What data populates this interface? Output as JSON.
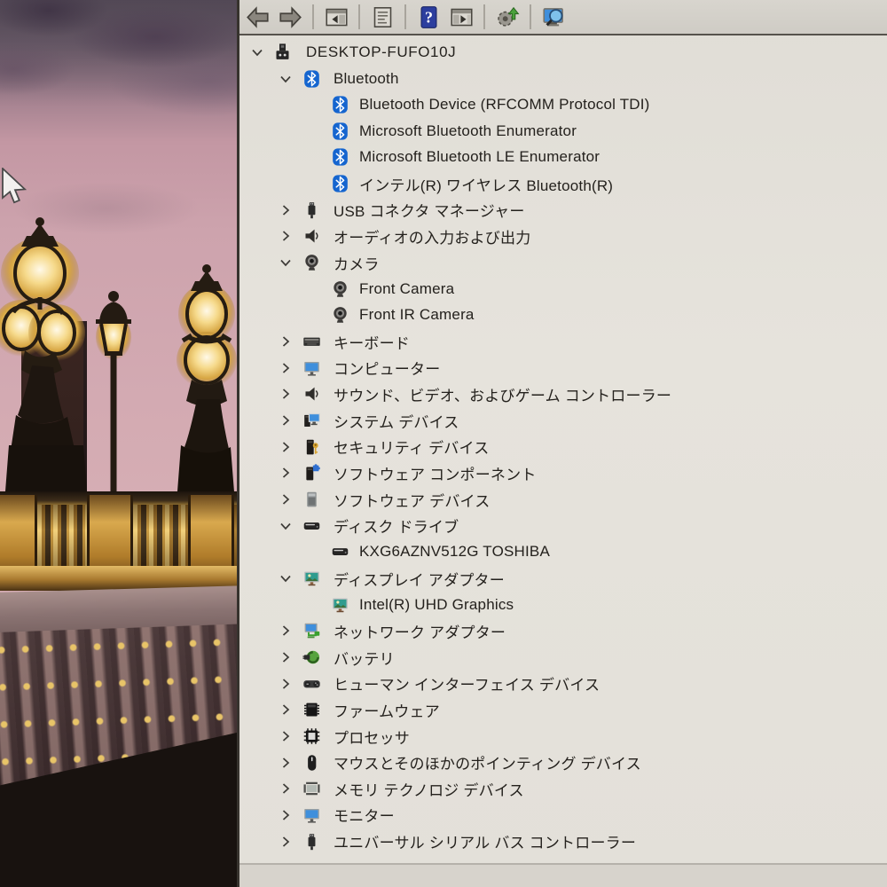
{
  "app": "device-manager",
  "colors": {
    "bluetooth_blue": "#1565cf",
    "help_blue": "#2c3e9e",
    "screen_blue": "#3f8fdc",
    "update_green": "#4aa23c",
    "gold": "#d9a94e",
    "sky_pink": "#d0a6af",
    "toolbar_bg": "#d3d0c9",
    "pane_bg": "#e2dfd8",
    "text": "#26231f"
  },
  "toolbar": {
    "items": [
      {
        "name": "back-button",
        "icon": "tb-back"
      },
      {
        "name": "forward-button",
        "icon": "tb-forward"
      },
      {
        "separator": true
      },
      {
        "name": "show-console-tree-button",
        "icon": "tb-console"
      },
      {
        "separator": true
      },
      {
        "name": "properties-button",
        "icon": "tb-props"
      },
      {
        "separator": true
      },
      {
        "name": "help-button",
        "icon": "tb-help"
      },
      {
        "name": "show-action-pane-button",
        "icon": "tb-action"
      },
      {
        "separator": true
      },
      {
        "name": "update-driver-button",
        "icon": "tb-update"
      },
      {
        "separator": true
      },
      {
        "name": "scan-hardware-changes-button",
        "icon": "tb-scan"
      }
    ]
  },
  "tree": {
    "rows": [
      {
        "id": "desktop-fufo10j",
        "label": "DESKTOP-FUFO10J",
        "icon": "computer",
        "level": 0,
        "chevron": "expanded"
      },
      {
        "id": "bluetooth",
        "label": "Bluetooth",
        "icon": "bluetooth",
        "level": 1,
        "chevron": "expanded"
      },
      {
        "id": "bluetooth-device-rfcomm-protocol-tdi",
        "label": "Bluetooth Device (RFCOMM Protocol TDI)",
        "icon": "bluetooth",
        "level": 2,
        "chevron": "none"
      },
      {
        "id": "microsoft-bluetooth-enumerator",
        "label": "Microsoft Bluetooth Enumerator",
        "icon": "bluetooth",
        "level": 2,
        "chevron": "none"
      },
      {
        "id": "microsoft-bluetooth-le-enumerator",
        "label": "Microsoft Bluetooth LE Enumerator",
        "icon": "bluetooth",
        "level": 2,
        "chevron": "none"
      },
      {
        "id": "intel-wireless-bluetooth",
        "label": "インテル(R) ワイヤレス Bluetooth(R)",
        "icon": "bluetooth",
        "level": 2,
        "chevron": "none"
      },
      {
        "id": "usb-connector-manager",
        "label": "USB コネクタ マネージャー",
        "icon": "usb",
        "level": 1,
        "chevron": "collapsed"
      },
      {
        "id": "audio-inputs-and-outputs",
        "label": "オーディオの入力および出力",
        "icon": "audio",
        "level": 1,
        "chevron": "collapsed"
      },
      {
        "id": "camera",
        "label": "カメラ",
        "icon": "camera",
        "level": 1,
        "chevron": "expanded"
      },
      {
        "id": "front-camera",
        "label": "Front Camera",
        "icon": "camera",
        "level": 2,
        "chevron": "none"
      },
      {
        "id": "front-ir-camera",
        "label": "Front IR Camera",
        "icon": "camera",
        "level": 2,
        "chevron": "none"
      },
      {
        "id": "keyboard",
        "label": "キーボード",
        "icon": "keyboard",
        "level": 1,
        "chevron": "collapsed"
      },
      {
        "id": "computer-group",
        "label": "コンピューター",
        "icon": "monitor",
        "level": 1,
        "chevron": "collapsed"
      },
      {
        "id": "sound-video-and-game-controllers",
        "label": "サウンド、ビデオ、およびゲーム コントローラー",
        "icon": "audio",
        "level": 1,
        "chevron": "collapsed"
      },
      {
        "id": "system-devices",
        "label": "システム デバイス",
        "icon": "system",
        "level": 1,
        "chevron": "collapsed"
      },
      {
        "id": "security-devices",
        "label": "セキュリティ デバイス",
        "icon": "security",
        "level": 1,
        "chevron": "collapsed"
      },
      {
        "id": "software-components",
        "label": "ソフトウェア コンポーネント",
        "icon": "software-component",
        "level": 1,
        "chevron": "collapsed"
      },
      {
        "id": "software-devices",
        "label": "ソフトウェア デバイス",
        "icon": "software-device",
        "level": 1,
        "chevron": "collapsed"
      },
      {
        "id": "disk-drives",
        "label": "ディスク ドライブ",
        "icon": "disk",
        "level": 1,
        "chevron": "expanded"
      },
      {
        "id": "kxg6aznv512g-toshiba",
        "label": "KXG6AZNV512G TOSHIBA",
        "icon": "disk",
        "level": 2,
        "chevron": "none"
      },
      {
        "id": "display-adapters",
        "label": "ディスプレイ アダプター",
        "icon": "display",
        "level": 1,
        "chevron": "expanded"
      },
      {
        "id": "intel-uhd-graphics",
        "label": "Intel(R) UHD Graphics",
        "icon": "display",
        "level": 2,
        "chevron": "none"
      },
      {
        "id": "network-adapters",
        "label": "ネットワーク アダプター",
        "icon": "network",
        "level": 1,
        "chevron": "collapsed"
      },
      {
        "id": "battery",
        "label": "バッテリ",
        "icon": "battery",
        "level": 1,
        "chevron": "collapsed"
      },
      {
        "id": "human-interface-devices",
        "label": "ヒューマン インターフェイス デバイス",
        "icon": "hid",
        "level": 1,
        "chevron": "collapsed"
      },
      {
        "id": "firmware",
        "label": "ファームウェア",
        "icon": "firmware",
        "level": 1,
        "chevron": "collapsed"
      },
      {
        "id": "processors",
        "label": "プロセッサ",
        "icon": "processor",
        "level": 1,
        "chevron": "collapsed"
      },
      {
        "id": "mice-and-other-pointing-devices",
        "label": "マウスとそのほかのポインティング デバイス",
        "icon": "mouse",
        "level": 1,
        "chevron": "collapsed"
      },
      {
        "id": "memory-technology-devices",
        "label": "メモリ テクノロジ デバイス",
        "icon": "memory",
        "level": 1,
        "chevron": "collapsed"
      },
      {
        "id": "monitors",
        "label": "モニター",
        "icon": "monitor",
        "level": 1,
        "chevron": "collapsed"
      },
      {
        "id": "universal-serial-bus-controllers",
        "label": "ユニバーサル シリアル バス コントローラー",
        "icon": "usb",
        "level": 1,
        "chevron": "collapsed"
      }
    ]
  }
}
